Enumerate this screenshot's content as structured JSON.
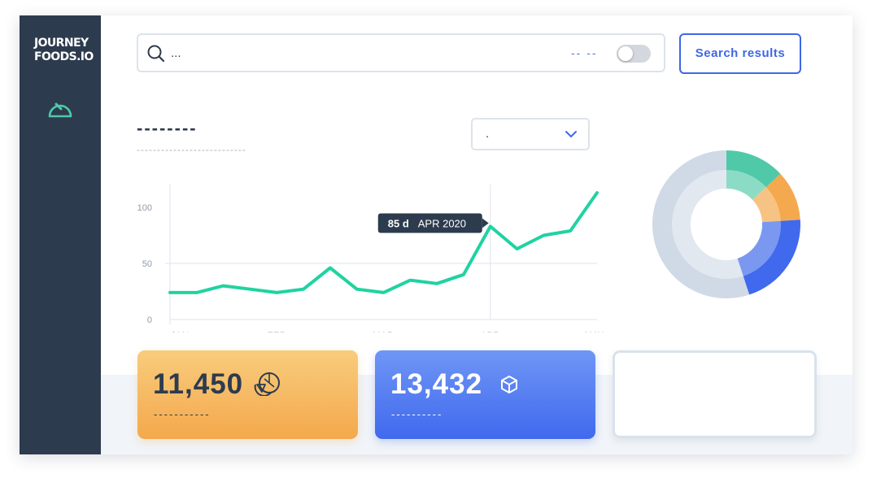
{
  "brand": {
    "logo_text": "JOURNEY\nFOODS.IO"
  },
  "sidebar": {
    "items": [
      {
        "icon": "dashboard-gauge-icon"
      }
    ]
  },
  "search": {
    "value": "...",
    "dashes": "-- --",
    "toggle_on": false,
    "button_label": "Search results"
  },
  "chart_header": {
    "title": "--------",
    "subtitle": "---------------------------",
    "dropdown_value": "."
  },
  "chart_data": {
    "type": "line",
    "categories": [
      "JAN",
      "FEB",
      "MAR",
      "APR",
      "MAY"
    ],
    "x": [
      0,
      0.25,
      0.5,
      0.75,
      1.0,
      1.25,
      1.5,
      1.75,
      2.0,
      2.25,
      2.5,
      2.75,
      3.0,
      3.25,
      3.5,
      3.75,
      4.0
    ],
    "series": [
      {
        "values": [
          24,
          24,
          30,
          27,
          24,
          27,
          46,
          27,
          24,
          35,
          32,
          40,
          83,
          63,
          75,
          79,
          113
        ]
      }
    ],
    "ylim": [
      0,
      100
    ],
    "yticks": [
      "100",
      "50",
      "0"
    ],
    "ytick_values": [
      100,
      50,
      0
    ],
    "marker": {
      "x": 3.0,
      "value_label": "85 d",
      "date_label": "APR 2020"
    },
    "color": "#1fd3a1"
  },
  "donut": {
    "segments": [
      {
        "value": 13,
        "color": "#4fc9a8",
        "inner_color": "#8cdcc5"
      },
      {
        "value": 11,
        "color": "#f5a94e",
        "inner_color": "#f7c384"
      },
      {
        "value": 21,
        "color": "#4069ee",
        "inner_color": "#7b98f0"
      },
      {
        "value": 55,
        "color": "#cfdae6",
        "inner_color": "#e2e8f0"
      }
    ]
  },
  "cards": [
    {
      "value": "11,450",
      "sub": "-----------",
      "icon": "citrus-slice-icon",
      "color": "#f4a84c"
    },
    {
      "value": "13,432",
      "sub": "----------",
      "icon": "box-icon",
      "color": "#4069ee"
    },
    {
      "value": "",
      "sub": ""
    }
  ]
}
